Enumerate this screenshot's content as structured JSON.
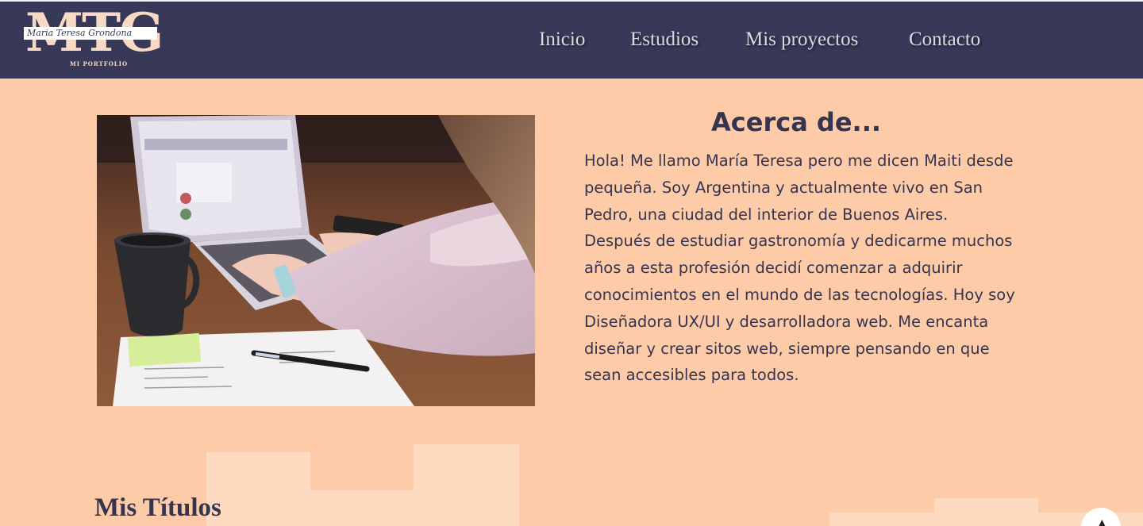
{
  "logo": {
    "letters": "MTG",
    "script_name": "Maria Teresa Grondona",
    "subtitle": "MI PORTFOLIO"
  },
  "nav": {
    "items": [
      {
        "label": "Inicio"
      },
      {
        "label": "Estudios"
      },
      {
        "label": "Mis proyectos"
      },
      {
        "label": "Contacto"
      }
    ]
  },
  "about": {
    "title": "Acerca de...",
    "text": "Hola! Me llamo María Teresa pero me dicen Maiti desde pequeña. Soy Argentina y actualmente vivo en San Pedro, una ciudad del interior de Buenos Aires. Después de estudiar gastronomía y dedicarme muchos años a esta profesión decidí comenzar a adquirir conocimientos en el mundo de las tecnologías. Hoy soy Diseñadora UX/UI y desarrolladora web. Me encanta diseñar y crear sitos web, siempre pensando en que sean accesibles para todos."
  },
  "titles_section": {
    "heading": "Mis Títulos"
  },
  "colors": {
    "header_bg": "#383858",
    "page_bg": "#fdcba8",
    "text": "#36344f",
    "nav_text": "#d9d9df"
  }
}
